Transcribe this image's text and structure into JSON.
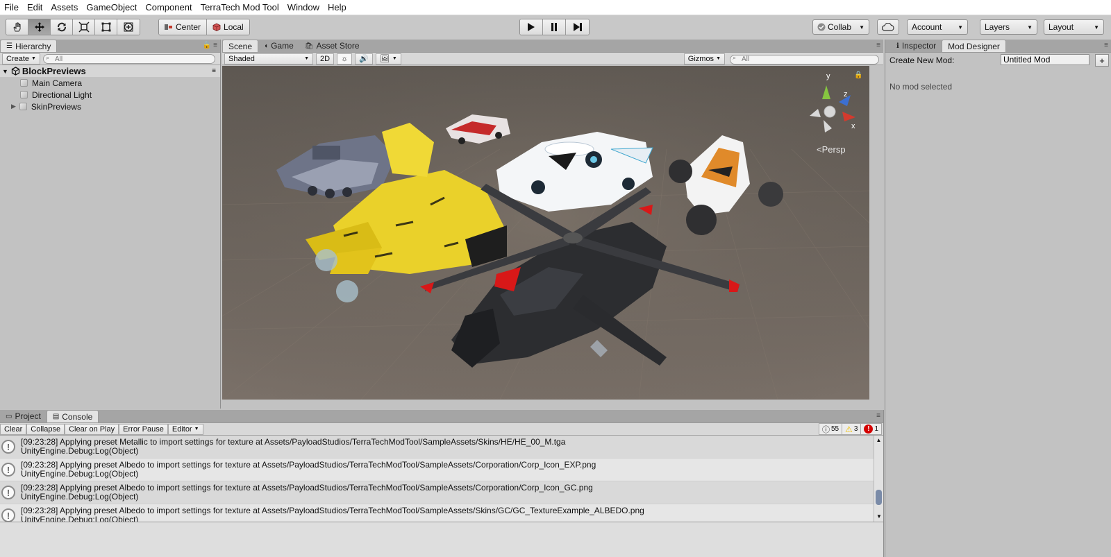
{
  "menu": [
    "File",
    "Edit",
    "Assets",
    "GameObject",
    "Component",
    "TerraTech Mod Tool",
    "Window",
    "Help"
  ],
  "toolbar": {
    "tools": [
      "hand-tool",
      "move-tool",
      "rotate-tool",
      "scale-tool",
      "rect-tool",
      "transform-tool"
    ],
    "pivot_center": "Center",
    "pivot_local": "Local",
    "collab": "Collab",
    "account": "Account",
    "layers": "Layers",
    "layout": "Layout"
  },
  "hierarchy": {
    "tab": "Hierarchy",
    "create": "Create",
    "search_placeholder": "All",
    "scene_name": "BlockPreviews",
    "items": [
      "Main Camera",
      "Directional Light",
      "SkinPreviews"
    ]
  },
  "scene": {
    "tabs": [
      "Scene",
      "Game",
      "Asset Store"
    ],
    "shading": "Shaded",
    "mode_2d": "2D",
    "gizmos": "Gizmos",
    "search_placeholder": "All",
    "gizmo_y": "y",
    "gizmo_z": "z",
    "gizmo_x": "x",
    "persp": "<Persp"
  },
  "inspector": {
    "tabs": [
      "Inspector",
      "Mod Designer"
    ],
    "create_label": "Create New Mod:",
    "mod_name": "Untitled Mod",
    "add_label": "+",
    "empty_text": "No mod selected"
  },
  "console": {
    "tabs": [
      "Project",
      "Console"
    ],
    "buttons": [
      "Clear",
      "Collapse",
      "Clear on Play",
      "Error Pause",
      "Editor"
    ],
    "log_count": "55",
    "warn_count": "3",
    "error_count": "1",
    "entries": [
      {
        "line1": "[09:23:28] Applying preset Metallic to import settings for texture at Assets/PayloadStudios/TerraTechModTool/SampleAssets/Skins/HE/HE_00_M.tga",
        "line2": "UnityEngine.Debug:Log(Object)"
      },
      {
        "line1": "[09:23:28] Applying preset Albedo to import settings for texture at Assets/PayloadStudios/TerraTechModTool/SampleAssets/Corporation/Corp_Icon_EXP.png",
        "line2": "UnityEngine.Debug:Log(Object)"
      },
      {
        "line1": "[09:23:28] Applying preset Albedo to import settings for texture at Assets/PayloadStudios/TerraTechModTool/SampleAssets/Corporation/Corp_Icon_GC.png",
        "line2": "UnityEngine.Debug:Log(Object)"
      },
      {
        "line1": "[09:23:28] Applying preset Albedo to import settings for texture at Assets/PayloadStudios/TerraTechModTool/SampleAssets/Skins/GC/GC_TextureExample_ALBEDO.png",
        "line2": "UnityEngine.Debug:Log(Object)"
      }
    ]
  },
  "colors": {
    "panel_bg": "#c2c2c2",
    "scene_ground": "#6a625a",
    "tab_active": "#e4e4e4",
    "warning": "#f0c000",
    "error": "#d40000"
  }
}
